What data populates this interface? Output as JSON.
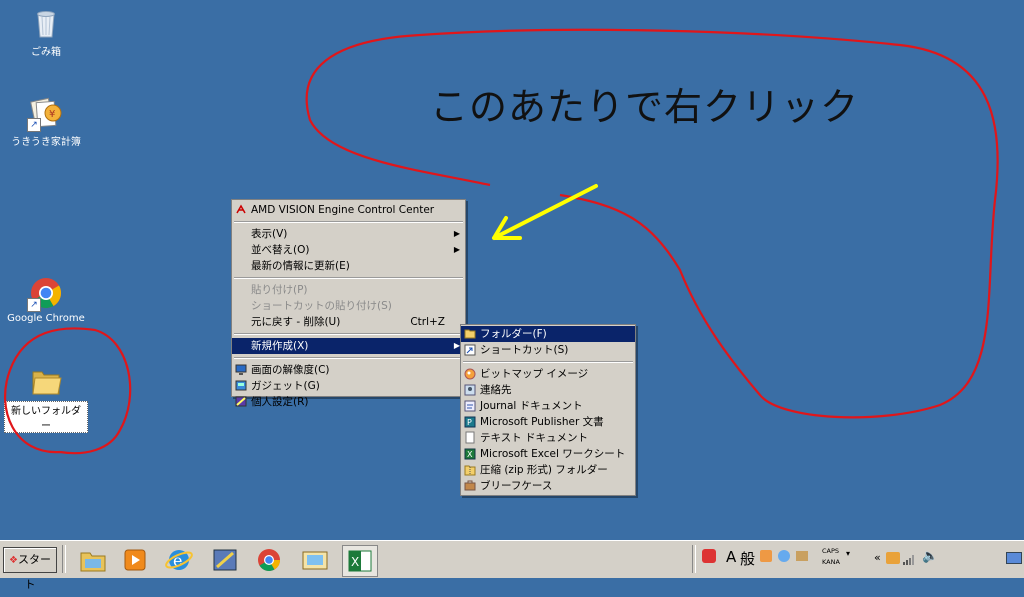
{
  "desktop": {
    "icons": [
      {
        "label": "ごみ箱"
      },
      {
        "label": "うきうき家計簿"
      },
      {
        "label": "Google Chrome"
      },
      {
        "label": "新しいフォルダー"
      }
    ],
    "annotation_text": "このあたりで右クリック"
  },
  "context_menu": {
    "items": [
      {
        "label": "AMD VISION Engine Control Center"
      },
      {
        "label": "表示(V)"
      },
      {
        "label": "並べ替え(O)"
      },
      {
        "label": "最新の情報に更新(E)"
      },
      {
        "label": "貼り付け(P)"
      },
      {
        "label": "ショートカットの貼り付け(S)"
      },
      {
        "label": "元に戻す - 削除(U)",
        "shortcut": "Ctrl+Z"
      },
      {
        "label": "新規作成(X)"
      },
      {
        "label": "画面の解像度(C)"
      },
      {
        "label": "ガジェット(G)"
      },
      {
        "label": "個人設定(R)"
      }
    ]
  },
  "submenu": {
    "items": [
      {
        "label": "フォルダー(F)"
      },
      {
        "label": "ショートカット(S)"
      },
      {
        "label": "ビットマップ イメージ"
      },
      {
        "label": "連絡先"
      },
      {
        "label": "Journal ドキュメント"
      },
      {
        "label": "Microsoft Publisher 文書"
      },
      {
        "label": "テキスト ドキュメント"
      },
      {
        "label": "Microsoft Excel ワークシート"
      },
      {
        "label": "圧縮 (zip 形式) フォルダー"
      },
      {
        "label": "ブリーフケース"
      }
    ]
  },
  "taskbar": {
    "start_label": "スタート",
    "ime_a": "A",
    "ime_mode": "般",
    "caps": "CAPS",
    "kana": "KANA"
  },
  "colors": {
    "desktop": "#3a6ea5",
    "menu_bg": "#d4d0c8",
    "highlight": "#0a246a",
    "annotation_red": "#e0161a",
    "arrow_yellow": "#ffff00"
  }
}
